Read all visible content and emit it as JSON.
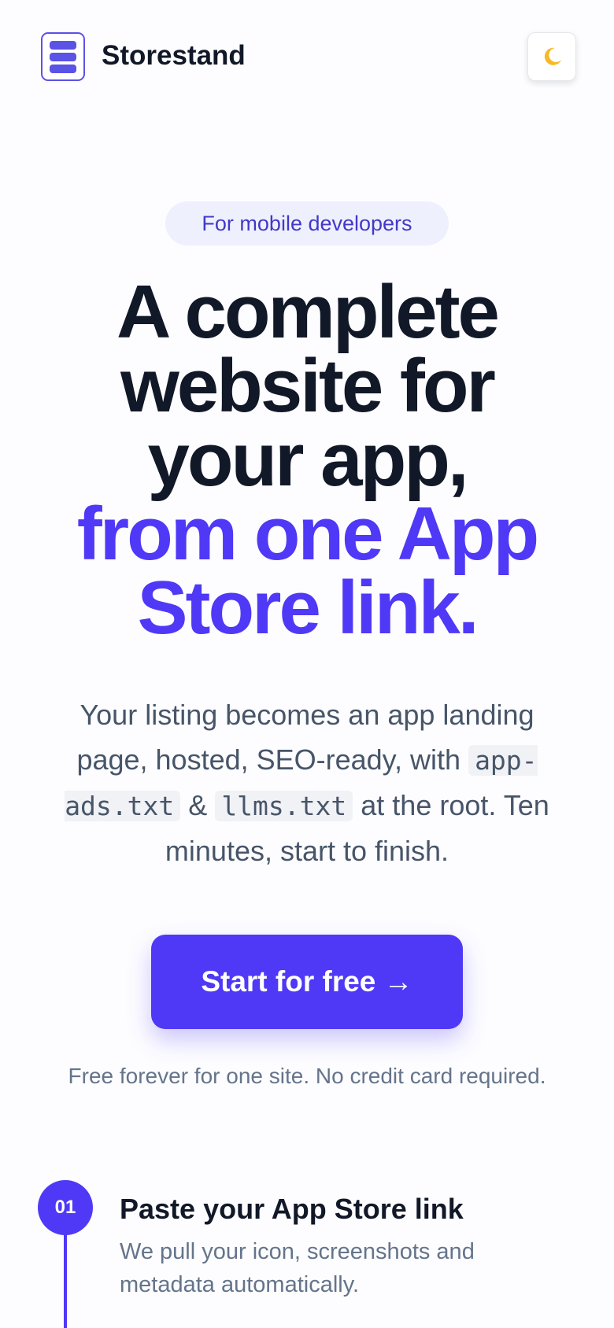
{
  "header": {
    "brand": "Storestand",
    "logo_icon": "stack-layers-icon",
    "theme_toggle_icon": "moon-icon",
    "theme_toggle_glyph": "🌙"
  },
  "hero": {
    "badge": "For mobile developers",
    "title_lines_dark": [
      "A complete",
      "website for",
      "your app,"
    ],
    "title_lines_accent": [
      "from one App",
      "Store link."
    ],
    "lede_part1": "Your listing becomes an app landing page, hosted, SEO-ready, with",
    "code1": "app-ads.txt",
    "ampersand": "&",
    "code2": "llms.txt",
    "lede_part2": "at the root. Ten minutes, start to finish."
  },
  "cta": {
    "label": "Start for free →",
    "note": "Free forever for one site. No credit card required."
  },
  "steps": [
    {
      "number": "01",
      "title": "Paste your App Store link",
      "description": "We pull your icon, screenshots and metadata automatically."
    }
  ],
  "colors": {
    "accent": "#4f39f6",
    "text_dark": "#111827",
    "text_muted": "#64748b",
    "badge_bg": "#eef0fd",
    "badge_text": "#4338ca"
  }
}
